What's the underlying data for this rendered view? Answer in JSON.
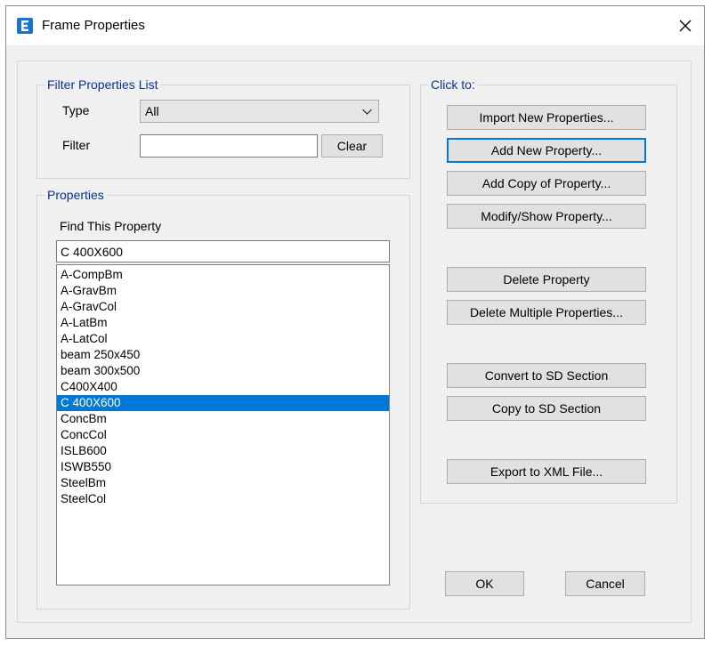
{
  "window": {
    "title": "Frame Properties",
    "app_icon_letter": "E",
    "accent_color": "#0078d7"
  },
  "filter": {
    "group_label": "Filter Properties List",
    "type_label": "Type",
    "type_value": "All",
    "filter_label": "Filter",
    "filter_value": "",
    "clear_label": "Clear"
  },
  "properties": {
    "group_label": "Properties",
    "find_label": "Find This Property",
    "find_value": "C 400X600",
    "items": [
      {
        "label": "A-CompBm"
      },
      {
        "label": "A-GravBm"
      },
      {
        "label": "A-GravCol"
      },
      {
        "label": "A-LatBm"
      },
      {
        "label": "A-LatCol"
      },
      {
        "label": "beam 250x450"
      },
      {
        "label": "beam 300x500"
      },
      {
        "label": "C400X400"
      },
      {
        "label": "C 400X600",
        "selected": true
      },
      {
        "label": "ConcBm"
      },
      {
        "label": "ConcCol"
      },
      {
        "label": "ISLB600"
      },
      {
        "label": "ISWB550"
      },
      {
        "label": "SteelBm"
      },
      {
        "label": "SteelCol"
      }
    ]
  },
  "actions": {
    "group_label": "Click to:",
    "import": "Import New Properties...",
    "add_new": "Add New Property...",
    "add_copy": "Add Copy of Property...",
    "modify": "Modify/Show Property...",
    "delete": "Delete Property",
    "delete_multiple": "Delete Multiple Properties...",
    "convert_sd": "Convert to SD Section",
    "copy_sd": "Copy to SD Section",
    "export_xml": "Export to XML File..."
  },
  "footer": {
    "ok": "OK",
    "cancel": "Cancel"
  }
}
